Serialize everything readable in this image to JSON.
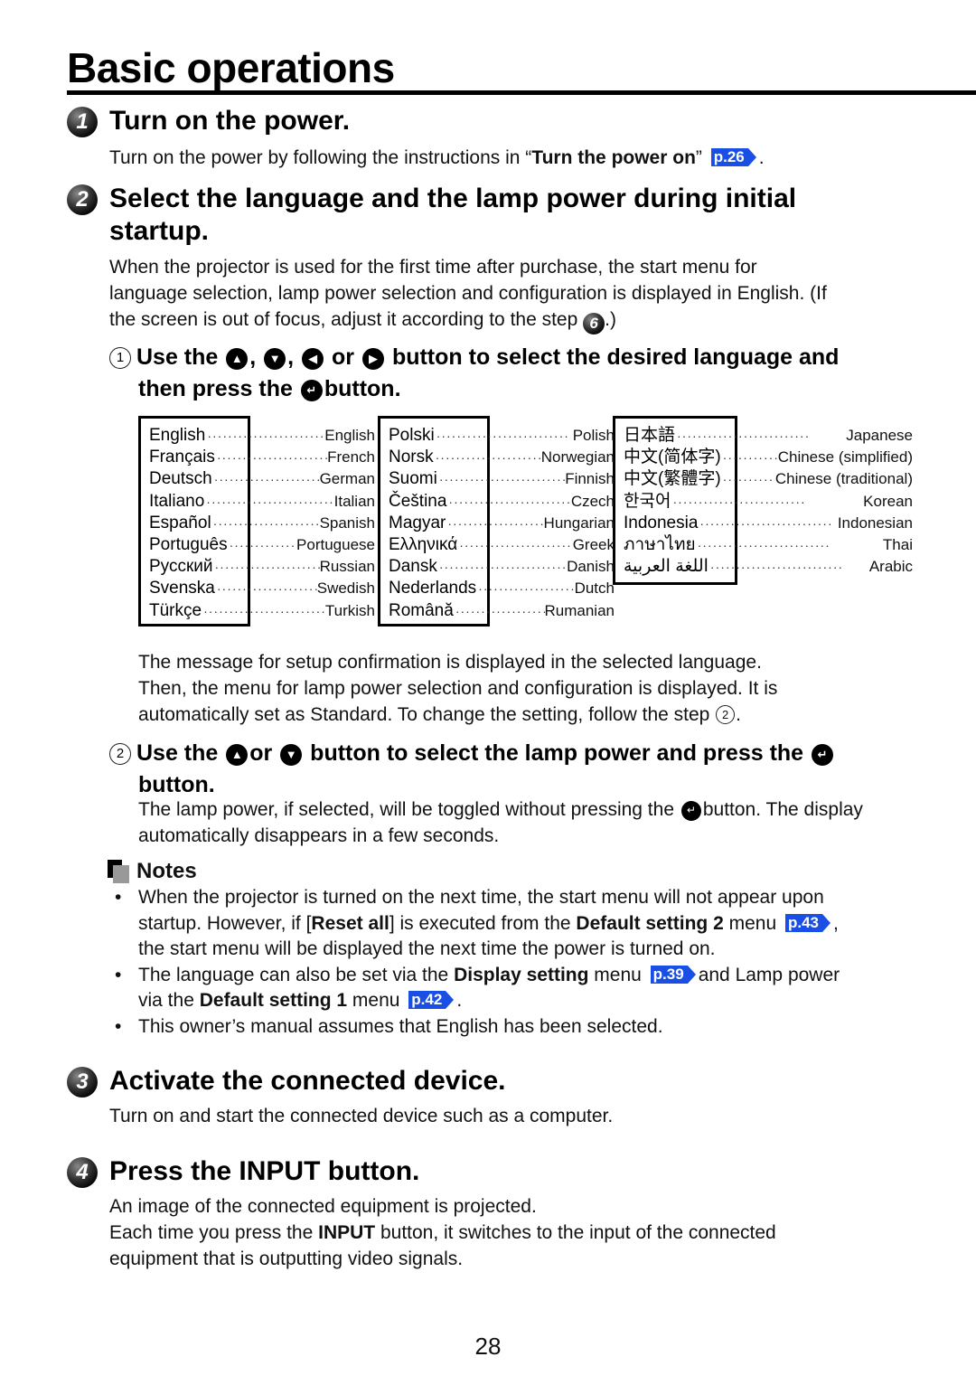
{
  "page": {
    "title": "Basic operations",
    "page_number": "28"
  },
  "colors": {
    "page_ref_bg": "#1a4fe6",
    "text": "#111111",
    "rule": "#000000"
  },
  "step1": {
    "number": "1",
    "title": "Turn on the power.",
    "text_before": "Turn on the power by following the instructions in “",
    "text_bold": "Turn the power on",
    "text_after": "”",
    "page_ref": "p.26",
    "text_end": "."
  },
  "step2": {
    "number": "2",
    "title_line1": "Select the language and the lamp power during initial",
    "title_line2": "startup.",
    "intro_line1": "When the projector is used for the first time after purchase, the start menu for",
    "intro_line2": "language selection, lamp power selection and configuration is displayed in English. (If",
    "intro_line3_before": "the screen is out of focus, adjust it according to the step",
    "intro_step_ref": "6",
    "intro_line3_after": ".)",
    "sub1": {
      "num": "1",
      "part1": "Use the",
      "sep1": ",",
      "sep2": ",",
      "or": "or",
      "part2": "button to select the desired language and",
      "line2_before": "then press the",
      "line2_after": "button.",
      "icons": {
        "up": "▲",
        "down": "▼",
        "left": "◀",
        "right": "▶",
        "enter": "↵"
      }
    },
    "languages": {
      "column1": [
        {
          "native": "English",
          "english": "English"
        },
        {
          "native": "Français",
          "english": "French"
        },
        {
          "native": "Deutsch",
          "english": "German"
        },
        {
          "native": "Italiano",
          "english": "Italian"
        },
        {
          "native": "Español",
          "english": "Spanish"
        },
        {
          "native": "Português",
          "english": "Portuguese"
        },
        {
          "native": "Русский",
          "english": "Russian"
        },
        {
          "native": "Svenska",
          "english": "Swedish"
        },
        {
          "native": "Türkçe",
          "english": "Turkish"
        }
      ],
      "column2": [
        {
          "native": "Polski",
          "english": "Polish"
        },
        {
          "native": "Norsk",
          "english": "Norwegian"
        },
        {
          "native": "Suomi",
          "english": "Finnish"
        },
        {
          "native": "Čeština",
          "english": "Czech"
        },
        {
          "native": "Magyar",
          "english": "Hungarian"
        },
        {
          "native": "Ελληνικά",
          "english": "Greek"
        },
        {
          "native": "Dansk",
          "english": "Danish"
        },
        {
          "native": "Nederlands",
          "english": "Dutch"
        },
        {
          "native": "Română",
          "english": "Rumanian"
        }
      ],
      "column3": [
        {
          "native": "日本語",
          "english": "Japanese"
        },
        {
          "native": "中文(简体字)",
          "english": "Chinese (simplified)"
        },
        {
          "native": "中文(繁體字)",
          "english": "Chinese (traditional)"
        },
        {
          "native": "한국어",
          "english": "Korean"
        },
        {
          "native": "Indonesia",
          "english": "Indonesian"
        },
        {
          "native": "ภาษาไทย",
          "english": "Thai"
        },
        {
          "native": "اللغة العربية",
          "english": "Arabic"
        }
      ],
      "dots": "··························"
    },
    "confirm_line1": "The message for setup confirmation is displayed in the selected language.",
    "confirm_line2": "Then, the menu for lamp power selection and configuration is displayed. It is",
    "confirm_line3_before": "automatically set as Standard. To change the setting, follow the step",
    "confirm_step_ref": "2",
    "confirm_line3_after": ".",
    "sub2": {
      "num": "2",
      "part1": "Use the",
      "or": "or",
      "part2": "button to select the lamp power and press the",
      "line2": "button.",
      "desc_line1_before": "The lamp power, if selected, will be toggled without pressing the",
      "desc_line1_after": "button. The display",
      "desc_line2": "automatically disappears in a few seconds."
    }
  },
  "notes": {
    "title": "Notes",
    "items": [
      {
        "l1": "When the projector is turned on the next time, the start menu will not appear upon",
        "l2_a": "startup. However, if [",
        "l2_b": "Reset all",
        "l2_c": "] is executed from the ",
        "l2_d": "Default setting 2",
        "l2_e": " menu",
        "ref": "p.43",
        "l2_f": ",",
        "l3": "the start menu will be displayed the next time the power is turned on."
      },
      {
        "l1_a": "The language can also be set via the ",
        "l1_b": "Display setting",
        "l1_c": " menu",
        "ref1": "p.39",
        "l1_d": "and Lamp power",
        "l2_a": "via the ",
        "l2_b": "Default setting 1",
        "l2_c": " menu",
        "ref2": "p.42",
        "l2_d": "."
      },
      {
        "l1": "This owner’s manual assumes that English has been selected."
      }
    ]
  },
  "step3": {
    "number": "3",
    "title": "Activate the connected device.",
    "text": "Turn on and start the connected device such as a computer."
  },
  "step4": {
    "number": "4",
    "title": "Press the INPUT button.",
    "line1": "An image of the connected equipment is projected.",
    "line2_a": "Each time you press the ",
    "line2_b": "INPUT",
    "line2_c": " button, it switches to the input of the connected",
    "line3": "equipment that is outputting video signals."
  }
}
